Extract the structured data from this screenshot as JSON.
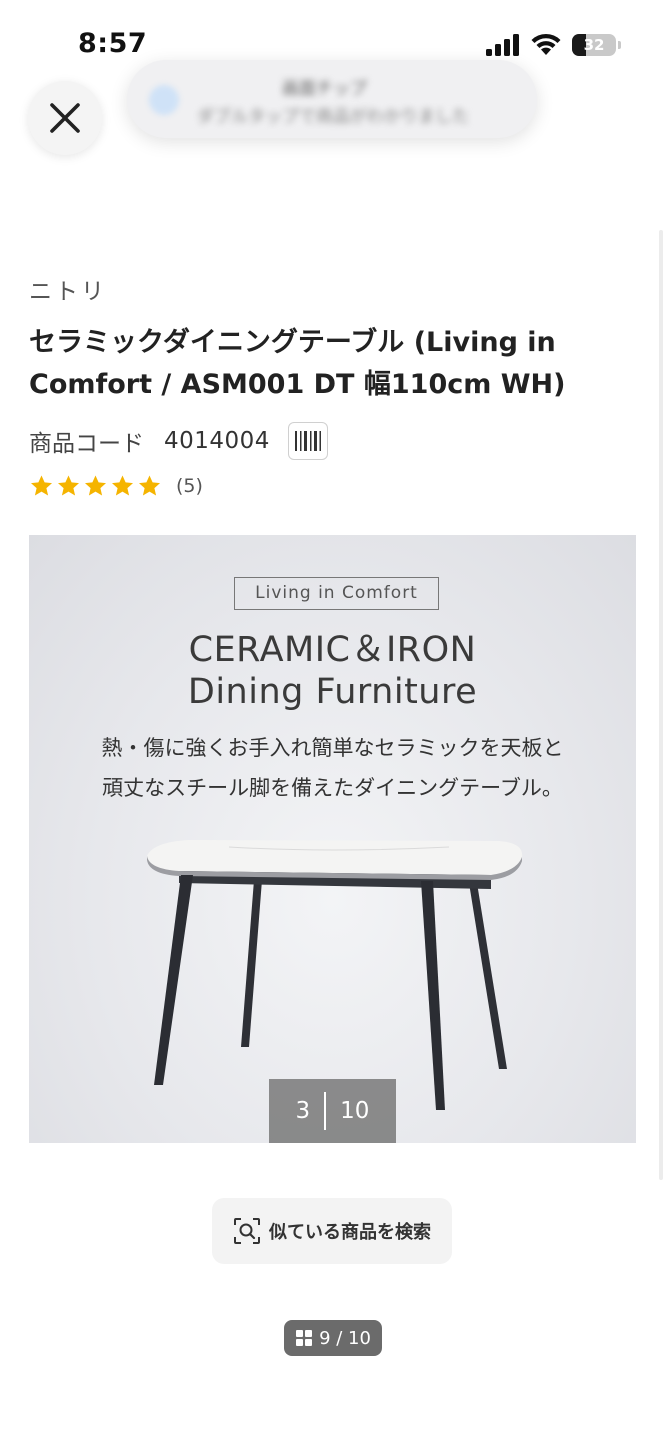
{
  "status_bar": {
    "time": "8:57",
    "battery": "32",
    "battery_level": 0.32
  },
  "overlay": {
    "close_icon": "close-icon",
    "toast_title": "画面チップ",
    "toast_subtitle": "ダブルタップで商品がわかりました"
  },
  "product": {
    "brand": "ニトリ",
    "title": "セラミックダイニングテーブル (Living in Comfort / ASM001 DT 幅110cm WH)",
    "code_label": "商品コード",
    "code_value": "4014004",
    "rating": 5,
    "review_count": "(5)"
  },
  "image": {
    "tag": "Living in Comfort",
    "heading_line1": "CERAMIC＆IRON",
    "heading_line2": "Dining Furniture",
    "desc_line1": "熱・傷に強くお手入れ簡単なセラミックを天板と",
    "desc_line2": "頑丈なスチール脚を備えたダイニングテーブル。",
    "current": "3",
    "total": "10"
  },
  "actions": {
    "similar_search_label": "似ている商品を検索"
  },
  "pager": {
    "label": "9 / 10"
  },
  "colors": {
    "star": "#f5b400",
    "counter_bg": "#6e6e6e",
    "pager_bg": "#6b6b6b"
  }
}
